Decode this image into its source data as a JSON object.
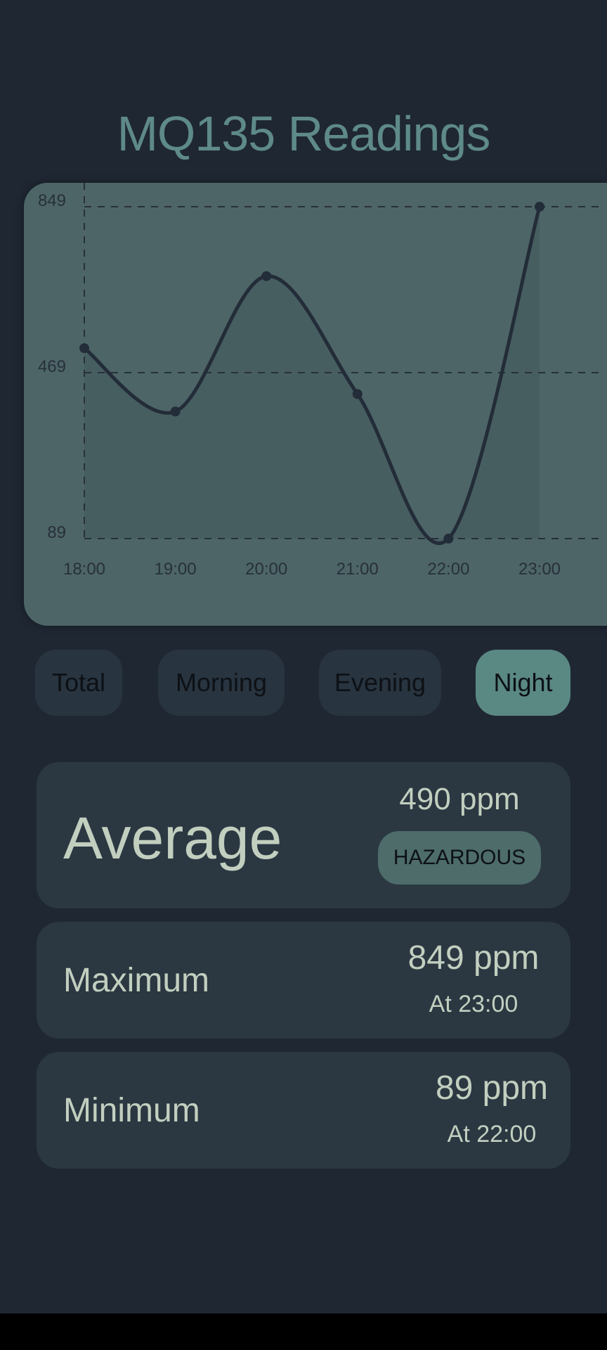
{
  "header": {
    "title": "MQ135 Readings"
  },
  "chart_data": {
    "type": "line",
    "title": "",
    "xlabel": "",
    "ylabel": "",
    "categories": [
      "18:00",
      "19:00",
      "20:00",
      "21:00",
      "22:00",
      "23:00"
    ],
    "x": [
      "18:00",
      "19:00",
      "20:00",
      "21:00",
      "22:00",
      "23:00"
    ],
    "series": [
      {
        "values": [
          525,
          380,
          690,
          420,
          89,
          849
        ]
      }
    ],
    "y_ticks": [
      "89",
      "469",
      "849"
    ],
    "ylim": [
      89,
      849
    ],
    "grid": true,
    "area_fill": true,
    "colors": {
      "line": "#232c39",
      "fill": "#465d60",
      "grid": "#27303b",
      "background": "#4d6566"
    }
  },
  "filters": {
    "items": [
      {
        "label": "Total"
      },
      {
        "label": "Morning"
      },
      {
        "label": "Evening"
      },
      {
        "label": "Night"
      }
    ],
    "selected": "Night"
  },
  "stats": {
    "average": {
      "label": "Average",
      "value": "490 ppm",
      "status": "HAZARDOUS"
    },
    "maximum": {
      "label": "Maximum",
      "value": "849 ppm",
      "time": "At 23:00"
    },
    "minimum": {
      "label": "Minimum",
      "value": "89 ppm",
      "time": "At 22:00"
    }
  },
  "colors": {
    "background": "#1f2733",
    "card": "#2b3842",
    "accent": "#5a8883",
    "text": "#c2cfbf"
  }
}
